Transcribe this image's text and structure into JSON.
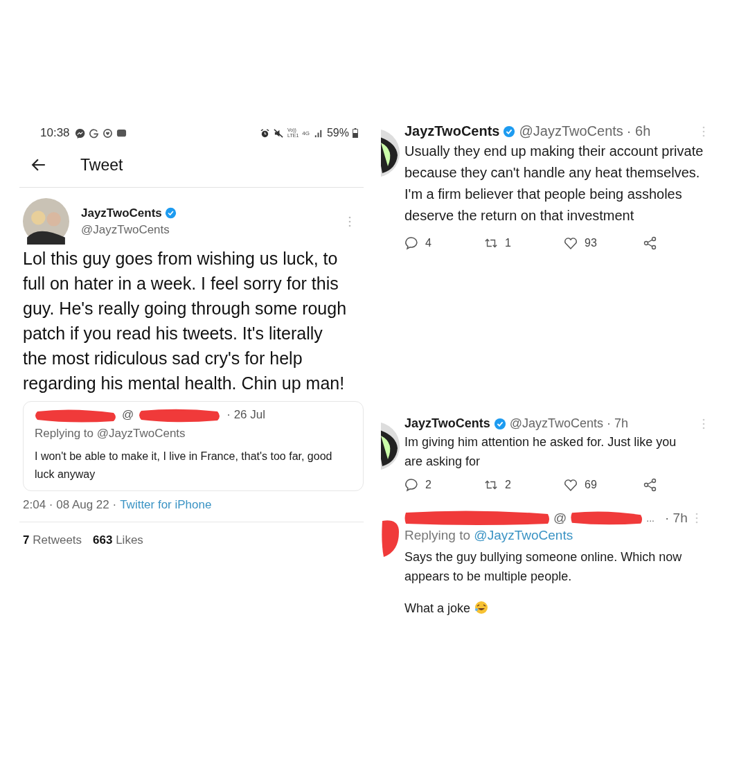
{
  "status_bar": {
    "time": "10:38",
    "network_labels": [
      "Vo))",
      "LTE1",
      "4G"
    ],
    "battery": "59%"
  },
  "header": {
    "title": "Tweet"
  },
  "main_tweet": {
    "name": "JayzTwoCents",
    "verified": true,
    "handle": "@JayzTwoCents",
    "text": "Lol this guy goes from wishing us luck, to full on hater in a week. I feel sorry for this guy. He's really going through some rough patch if you read his tweets. It's literally the most ridiculous sad cry's for help regarding his mental health. Chin up man!",
    "quoted": {
      "at": "@",
      "date": "· 26 Jul",
      "replying_label": "Replying to",
      "replying_handle": "@JayzTwoCents",
      "text": "I won't be able to make it, I live in France,  that's too far, good luck anyway"
    },
    "meta": "2:04 · 08 Aug 22 ·",
    "source": "Twitter for iPhone",
    "stats": [
      {
        "count": "7",
        "label": "Retweets"
      },
      {
        "count": "663",
        "label": "Likes"
      }
    ]
  },
  "replies": [
    {
      "kind": "tweet",
      "name": "JayzTwoCents",
      "verified": true,
      "handle": "@JayzTwoCents",
      "time": "· 6h",
      "text": "Usually they end up making their account private because they can't handle any heat themselves. I'm a firm believer that people being assholes deserve the return on that investment",
      "actions": [
        {
          "kind": "reply",
          "count": "4"
        },
        {
          "kind": "retweet",
          "count": "1"
        },
        {
          "kind": "like",
          "count": "93"
        },
        {
          "kind": "share"
        }
      ]
    },
    {
      "kind": "tweet",
      "name": "JayzTwoCents",
      "verified": true,
      "handle": "@JayzTwoCents",
      "time": "· 7h",
      "text": "Im giving him attention he asked for. Just like you are asking for",
      "actions": [
        {
          "kind": "reply",
          "count": "2"
        },
        {
          "kind": "retweet",
          "count": "2"
        },
        {
          "kind": "like",
          "count": "69"
        },
        {
          "kind": "share"
        }
      ]
    },
    {
      "kind": "redacted",
      "at": "@",
      "ellipsis": "...",
      "time": "· 7h",
      "replying_label": "Replying to",
      "replying_handle": "@JayzTwoCents",
      "paragraphs": [
        "Says the guy bullying someone online. Which now appears to be multiple people.",
        "What a joke"
      ],
      "emoji": true
    }
  ]
}
